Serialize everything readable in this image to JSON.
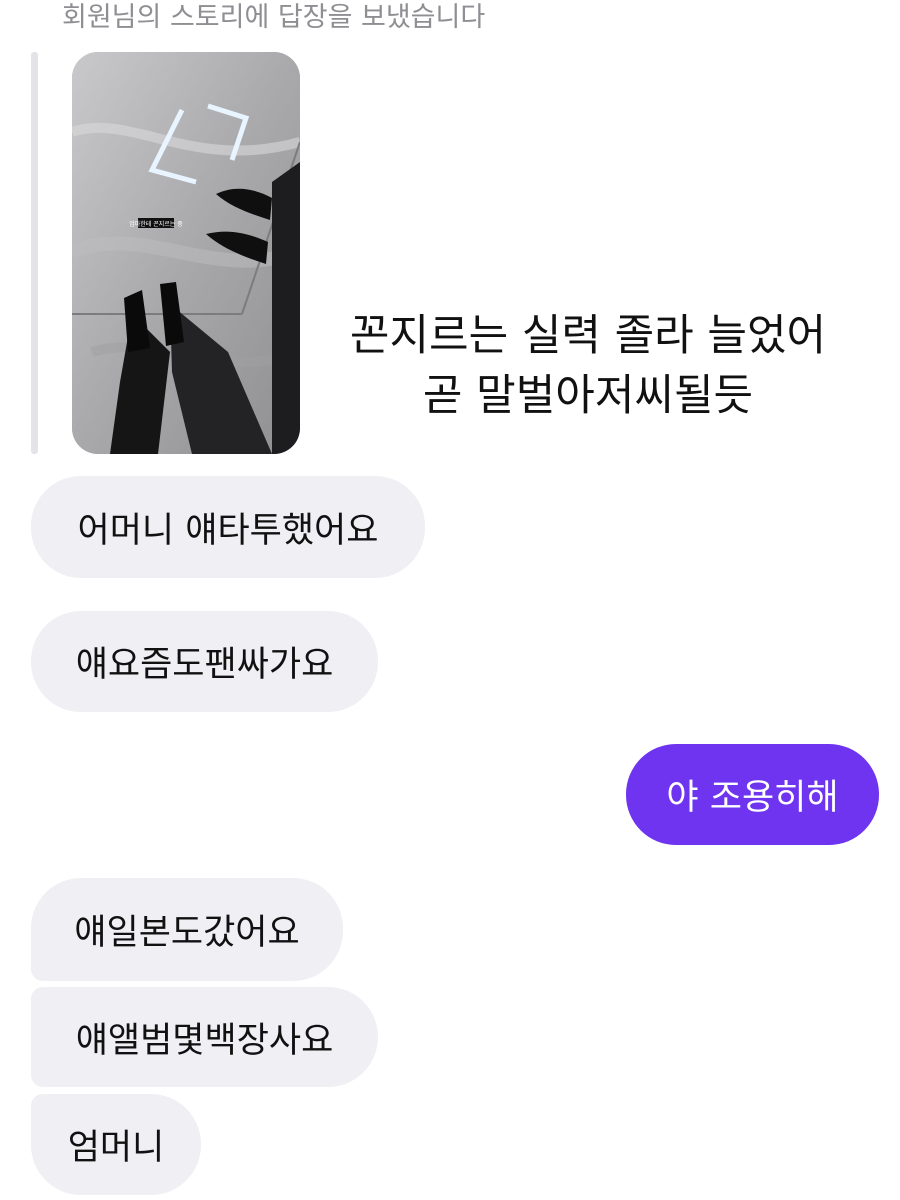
{
  "story_reply": {
    "header_text": "회원님의 스토리에 답장을 보냈습니다",
    "caption_line1": "꼰지르는 실력 졸라 늘었어",
    "caption_line2": "곧 말벌아저씨될듯",
    "sticker_text": "엄마한테 꼰지르는 중"
  },
  "messages": [
    {
      "text": "어머니 얘타투했어요",
      "direction": "incoming"
    },
    {
      "text": "얘요즘도팬싸가요",
      "direction": "incoming"
    },
    {
      "text": "야 조용히해",
      "direction": "outgoing"
    },
    {
      "text": "얘일본도갔어요",
      "direction": "incoming"
    },
    {
      "text": "얘앨범몇백장사요",
      "direction": "incoming"
    },
    {
      "text": "엄머니",
      "direction": "incoming"
    }
  ],
  "colors": {
    "outgoing_bubble": "#6e34f0",
    "incoming_bubble": "#efeff4",
    "header_text": "#8e8e93"
  }
}
